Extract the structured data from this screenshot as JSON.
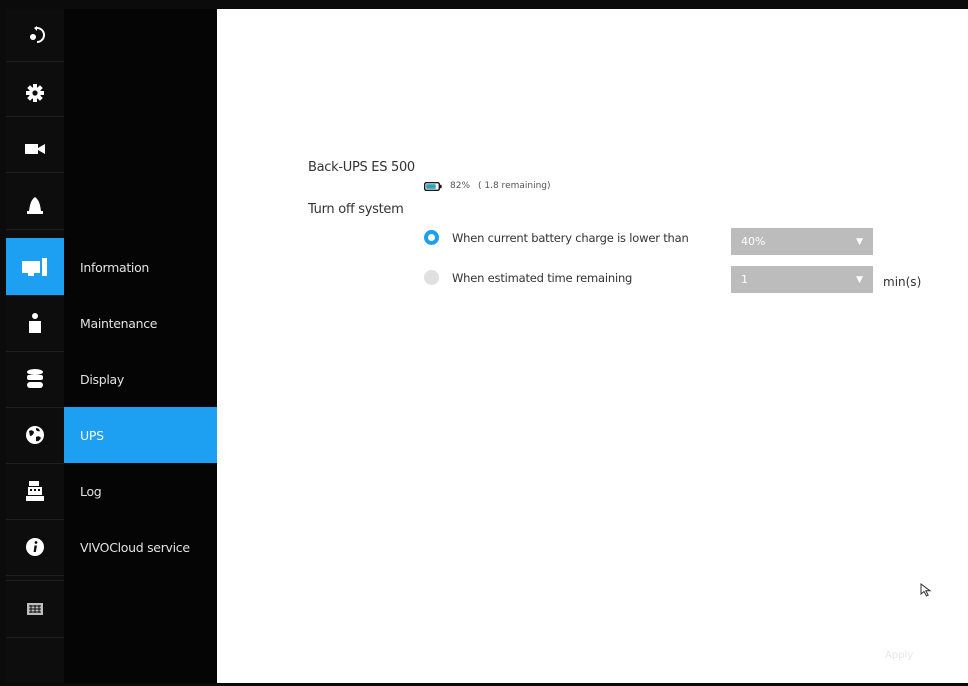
{
  "rail": {
    "items": [
      {
        "icon": "exit-icon",
        "active": false
      },
      {
        "icon": "gear-icon",
        "active": false
      },
      {
        "icon": "camera-icon",
        "active": false
      },
      {
        "icon": "alarm-icon",
        "active": false
      },
      {
        "icon": "system-icon",
        "active": true
      },
      {
        "icon": "user-icon",
        "active": false
      },
      {
        "icon": "storage-icon",
        "active": false
      },
      {
        "icon": "network-icon",
        "active": false
      },
      {
        "icon": "cashier-icon",
        "active": false
      },
      {
        "icon": "info-icon",
        "active": false
      },
      {
        "icon": "keyboard-icon",
        "active": false
      }
    ],
    "active_color": "#1d9ff2"
  },
  "submenu": {
    "items": [
      {
        "label": "Information",
        "active": false
      },
      {
        "label": "Maintenance",
        "active": false
      },
      {
        "label": "Display",
        "active": false
      },
      {
        "label": "UPS",
        "active": true
      },
      {
        "label": "Log",
        "active": false
      },
      {
        "label": "VIVOCloud service",
        "active": false
      }
    ]
  },
  "ups": {
    "name": "Back-UPS ES 500",
    "battery_percent": "82%",
    "battery_remaining": "( 1.8 remaining)",
    "battery_level": 0.82,
    "turn_off_label": "Turn off system",
    "options": [
      {
        "label": "When current battery charge is lower than",
        "selected": true,
        "select_value": "40%"
      },
      {
        "label": "When estimated time remaining",
        "selected": false,
        "select_value": "1"
      }
    ],
    "time_unit": "min(s)",
    "apply_label": "Apply"
  }
}
